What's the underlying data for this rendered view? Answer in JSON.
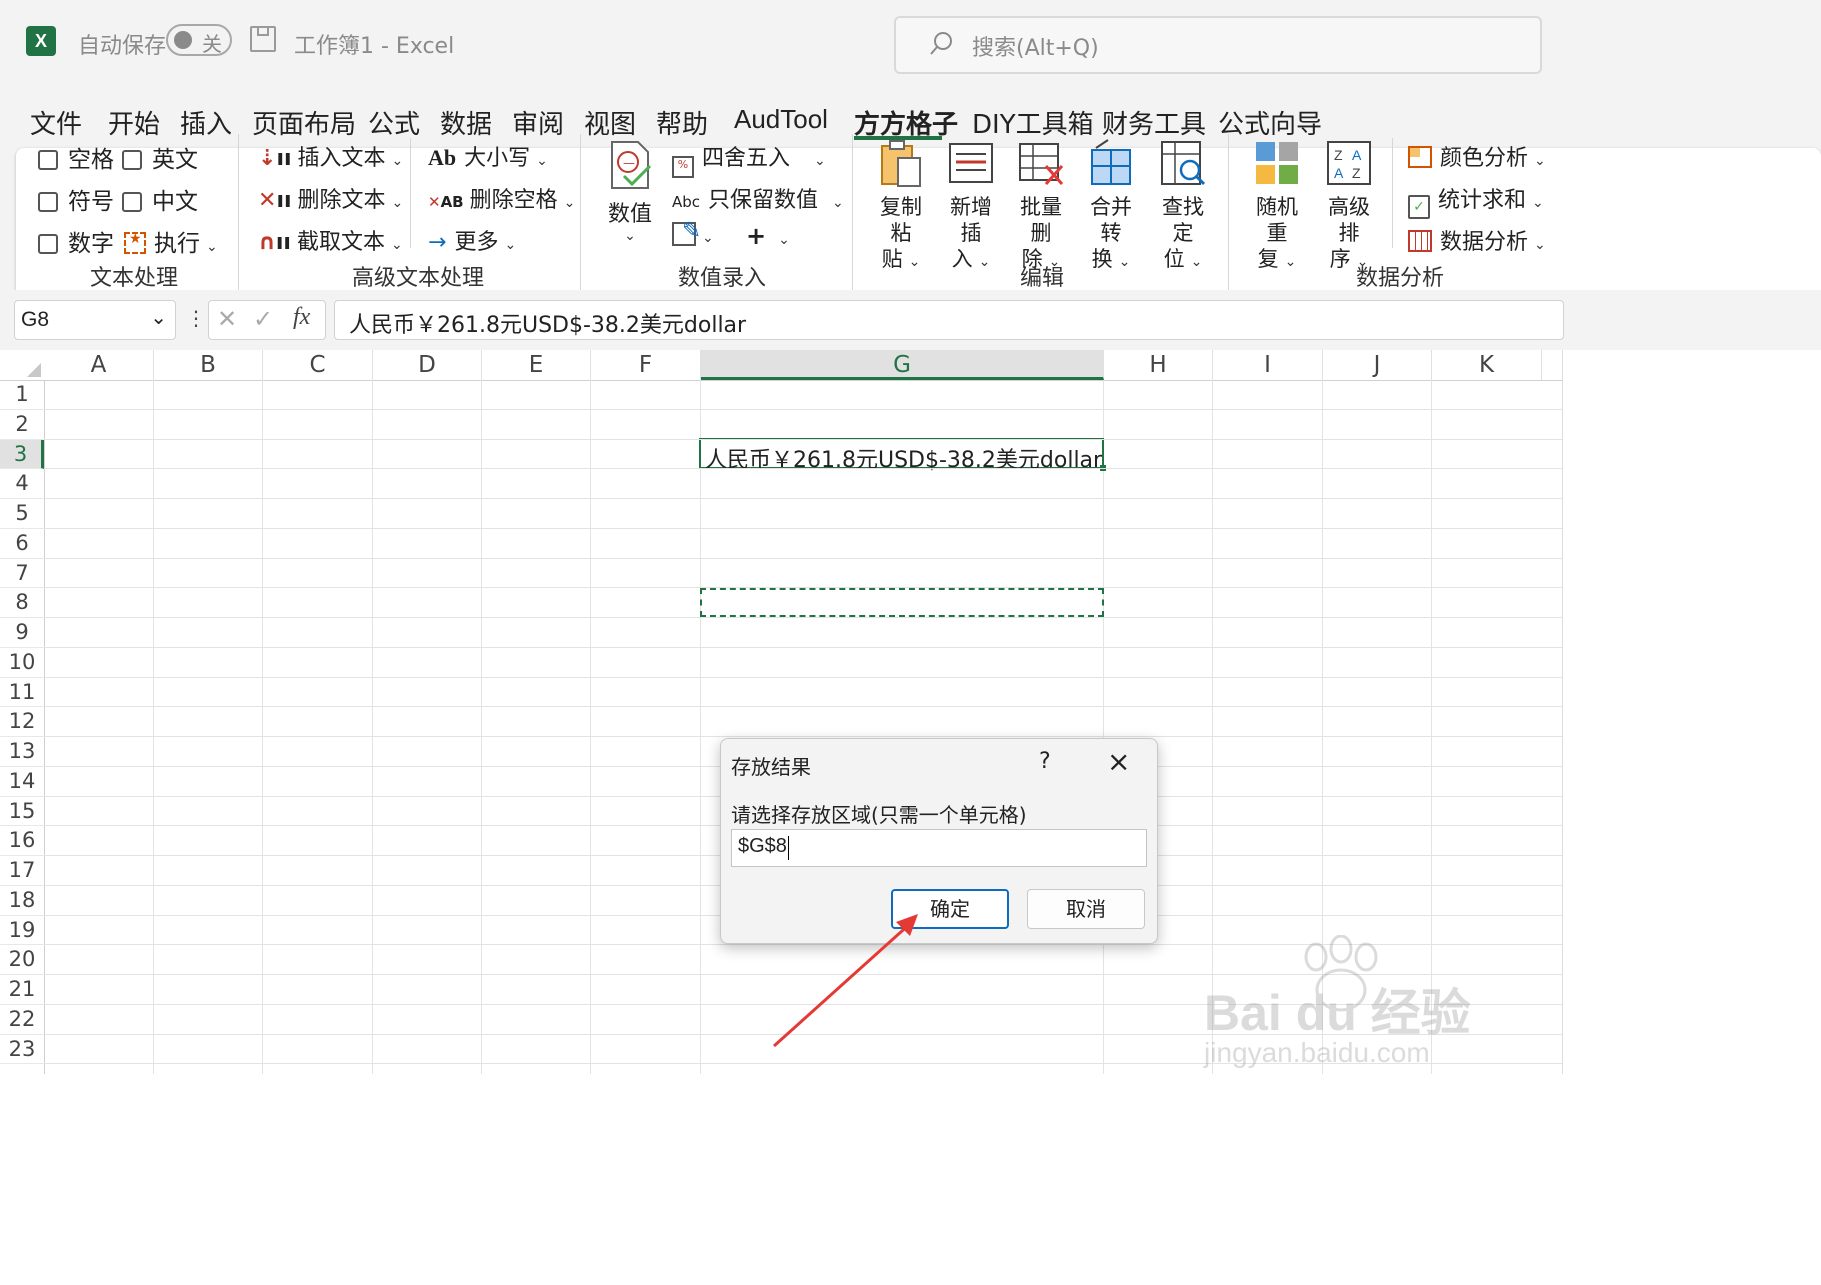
{
  "titlebar": {
    "autosave_label": "自动保存",
    "autosave_state": "关",
    "doc_title": "工作簿1 - Excel",
    "search_placeholder": "搜索(Alt+Q)"
  },
  "tabs": [
    "文件",
    "开始",
    "插入",
    "页面布局",
    "公式",
    "数据",
    "审阅",
    "视图",
    "帮助",
    "AudTool",
    "方方格子",
    "DIY工具箱",
    "财务工具",
    "公式向导"
  ],
  "active_tab": "方方格子",
  "ribbon": {
    "text_group": {
      "label": "文本处理",
      "checks": [
        "空格",
        "英文",
        "符号",
        "中文",
        "数字"
      ],
      "execute": "执行"
    },
    "advanced_text": {
      "label": "高级文本处理",
      "insert_text": "插入文本",
      "delete_text": "删除文本",
      "extract_text": "截取文本",
      "case": "大小写",
      "case_icon_text": "Ab",
      "delete_space": "删除空格",
      "delete_space_icon_text": "AB",
      "more": "更多"
    },
    "number_entry": {
      "label": "数值录入",
      "number": "数值",
      "round": "四舍五入",
      "keep_value": "只保留数值",
      "keep_value_icon_text": "Abc"
    },
    "edit": {
      "label": "编辑",
      "buttons": [
        {
          "line1": "复制粘",
          "line2": "贴"
        },
        {
          "line1": "新增插",
          "line2": "入"
        },
        {
          "line1": "批量删",
          "line2": "除"
        },
        {
          "line1": "合并转",
          "line2": "换"
        },
        {
          "line1": "查找定",
          "line2": "位"
        }
      ]
    },
    "data_analysis": {
      "label": "数据分析",
      "random": {
        "line1": "随机重",
        "line2": "复"
      },
      "sort": {
        "line1": "高级排",
        "line2": "序"
      },
      "color_analysis": "颜色分析",
      "sum": "统计求和",
      "analysis": "数据分析"
    }
  },
  "formula_bar": {
    "name_box": "G8",
    "fx": "fx",
    "content": "人民币￥261.8元USD$-38.2美元dollar"
  },
  "columns": [
    "A",
    "B",
    "C",
    "D",
    "E",
    "F",
    "G",
    "H",
    "I",
    "J",
    "K"
  ],
  "rows": [
    "1",
    "2",
    "3",
    "4",
    "5",
    "6",
    "7",
    "8",
    "9",
    "10",
    "11",
    "12",
    "13",
    "14",
    "15",
    "16",
    "17",
    "18",
    "19",
    "20",
    "21",
    "22",
    "23"
  ],
  "cell_G3": "人民币￥261.8元USD$-38.2美元dollar",
  "dialog": {
    "title": "存放结果",
    "help": "?",
    "prompt": "请选择存放区域(只需一个单元格)",
    "input_value": "$G$8",
    "ok": "确定",
    "cancel": "取消"
  },
  "watermark": {
    "line1": "Bai du 经验",
    "line2": "jingyan.baidu.com"
  },
  "colors": {
    "excel_green": "#217346",
    "arrow_red": "#e53935",
    "accent_blue": "#0f6cbd"
  }
}
